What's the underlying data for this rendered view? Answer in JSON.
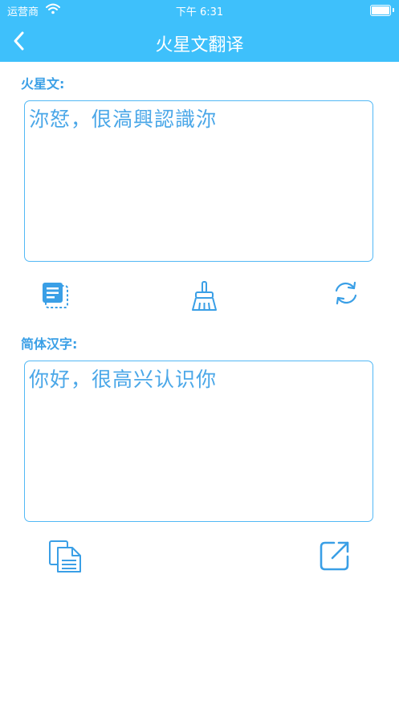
{
  "status_bar": {
    "carrier": "运营商",
    "time": "下午 6:31",
    "icons": [
      "wifi-icon",
      "battery-icon"
    ]
  },
  "nav": {
    "title": "火星文翻译",
    "back_icon": "chevron-left-icon"
  },
  "martian": {
    "label": "火星文:",
    "text": "沵恏，佷滈興認識沵",
    "actions": [
      "paste-icon",
      "broom-icon",
      "refresh-icon"
    ]
  },
  "simplified": {
    "label": "简体汉字:",
    "text": "你好，很高兴认识你",
    "actions": [
      "copy-icon",
      "share-icon"
    ]
  },
  "colors": {
    "accent": "#3ec0fb",
    "text": "#4aa7e8",
    "icon": "#3a9fe6",
    "border": "#52b8f5"
  }
}
